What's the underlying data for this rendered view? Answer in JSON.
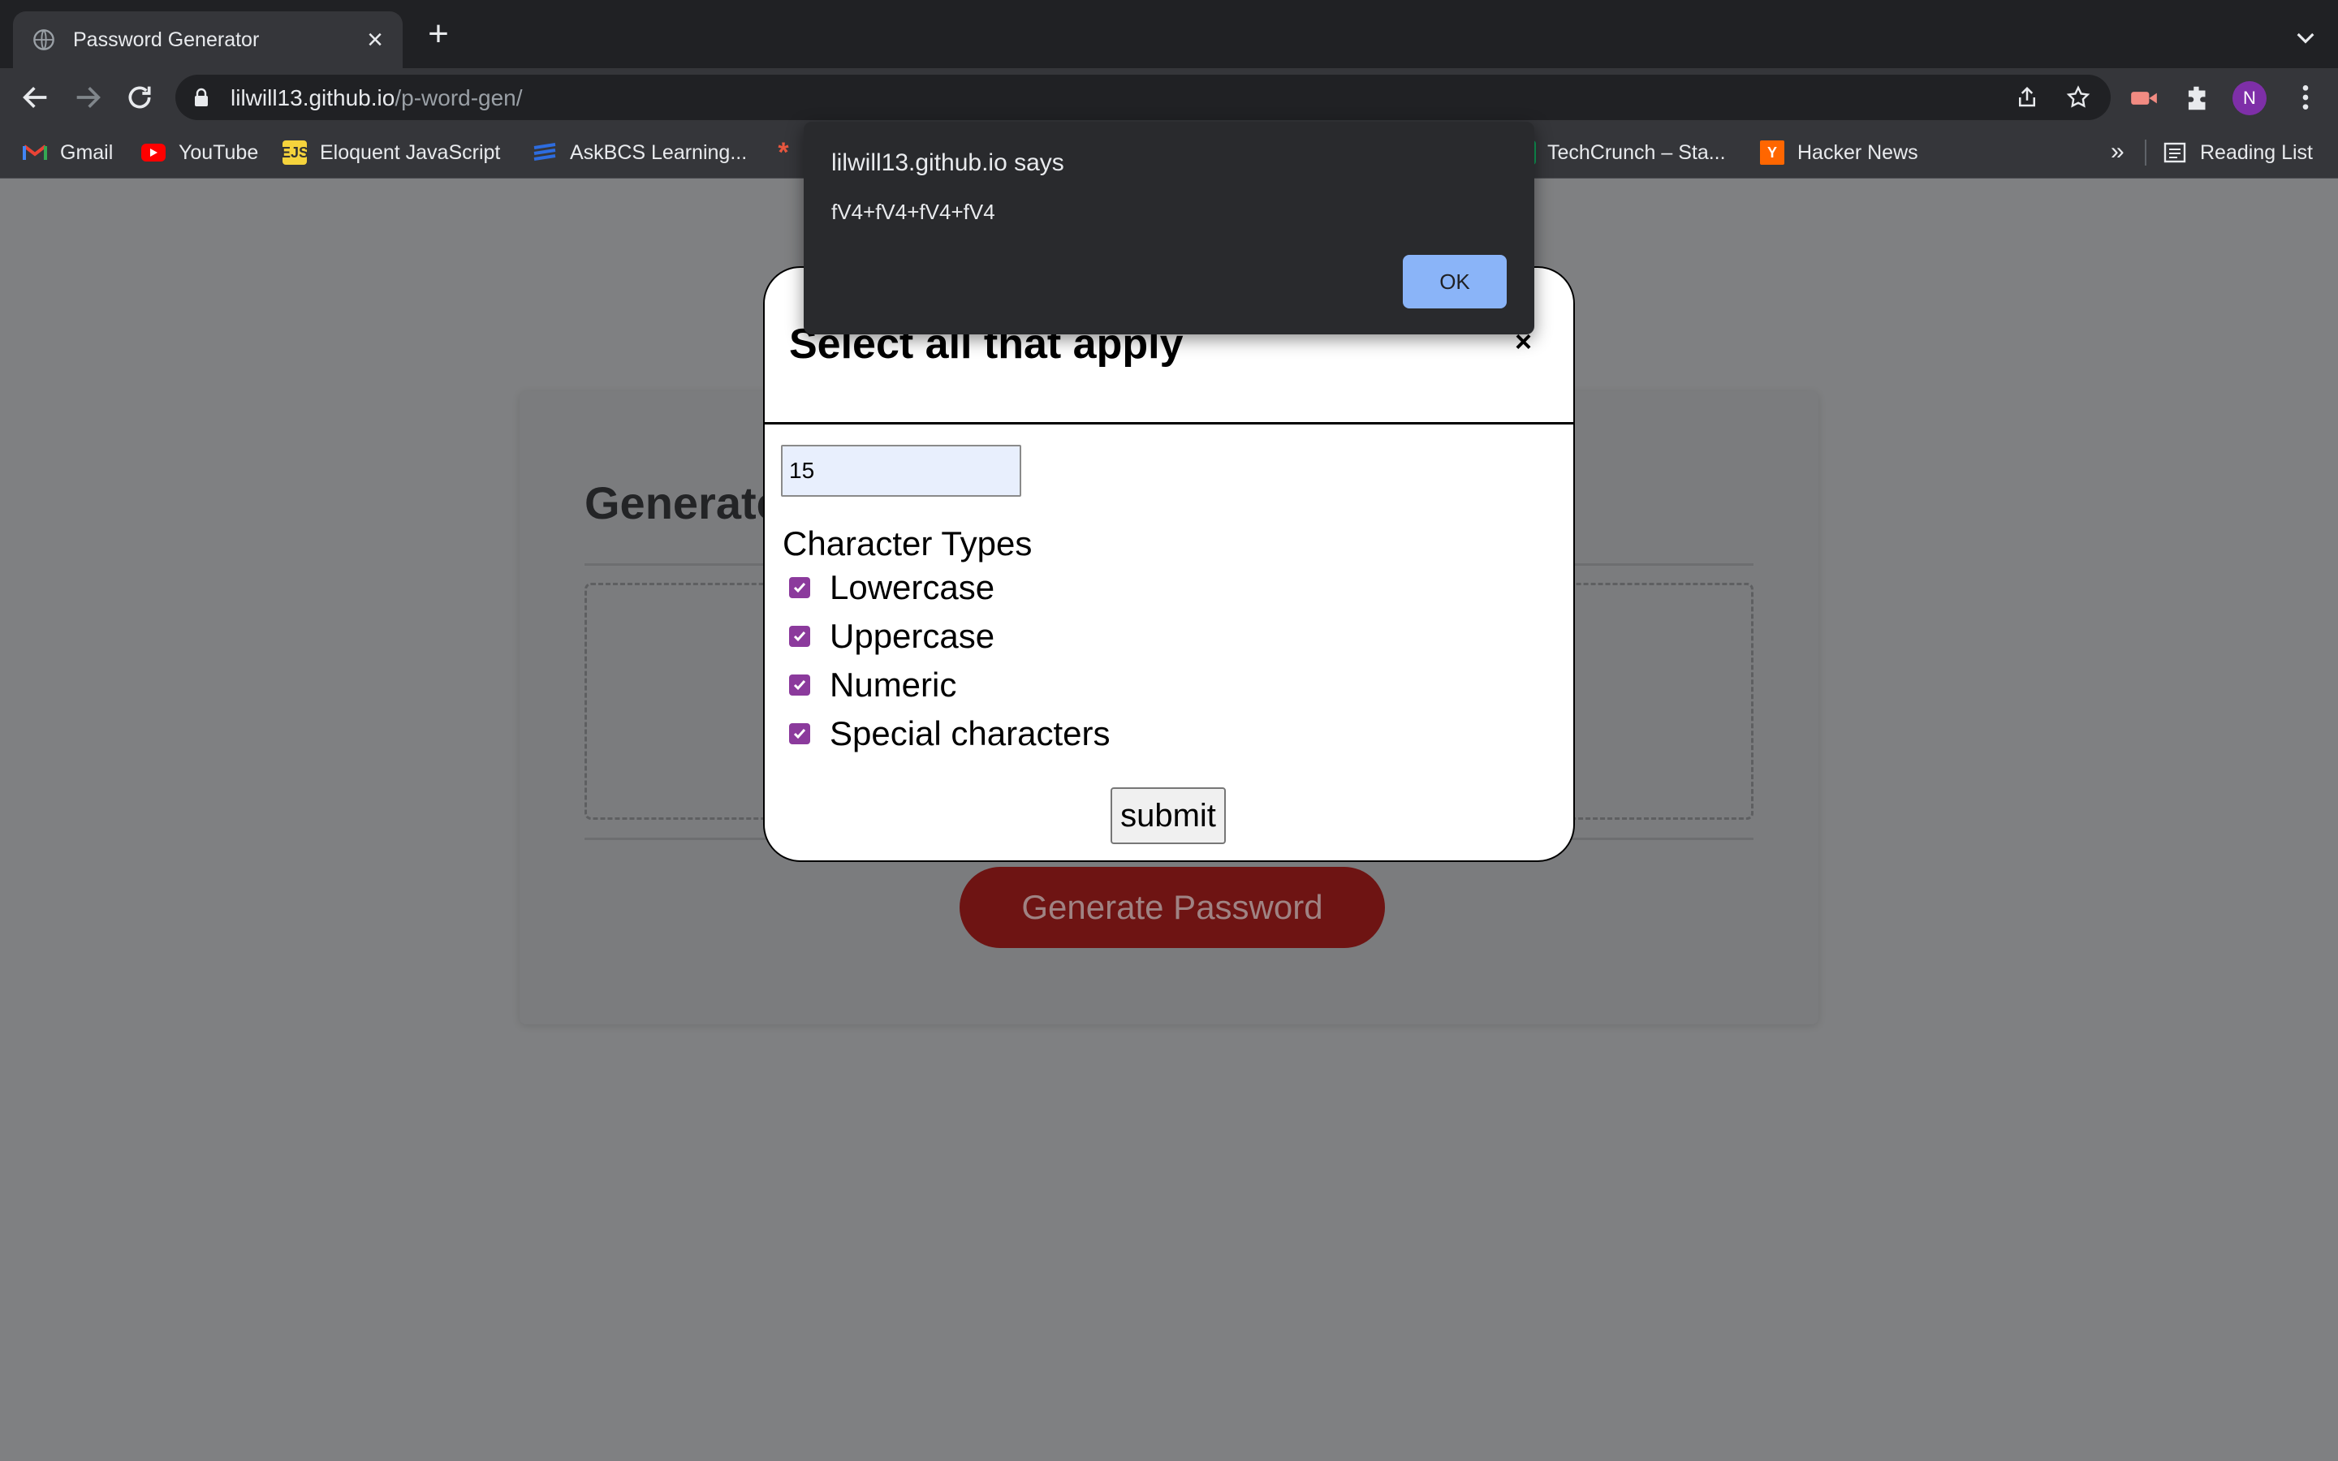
{
  "browser": {
    "tab": {
      "title": "Password Generator"
    },
    "url": {
      "host": "lilwill13.github.io",
      "path": "/p-word-gen/"
    },
    "profile_initial": "N",
    "bookmarks": [
      {
        "label": "Gmail",
        "icon": "gmail-icon"
      },
      {
        "label": "YouTube",
        "icon": "youtube-icon"
      },
      {
        "label": "Eloquent JavaScript",
        "icon": "ejs-icon"
      },
      {
        "label": "AskBCS Learning...",
        "icon": "askbcs-icon"
      },
      {
        "label": "TechCrunch – Sta...",
        "icon": "techcrunch-icon"
      },
      {
        "label": "Hacker News",
        "icon": "hacker-news-icon"
      }
    ],
    "reading_list": "Reading List",
    "more_bookmarks": "»"
  },
  "page": {
    "heading_partial": "Generate",
    "generate_button": "Generate Password"
  },
  "modal": {
    "title": "Select all that apply",
    "close": "×",
    "length_value": "15",
    "section_label": "Character Types",
    "options": [
      {
        "label": "Lowercase",
        "checked": true
      },
      {
        "label": "Uppercase",
        "checked": true
      },
      {
        "label": "Numeric",
        "checked": true
      },
      {
        "label": "Special characters",
        "checked": true
      }
    ],
    "submit": "submit"
  },
  "alert": {
    "origin": "lilwill13.github.io says",
    "message": "fV4+fV4+fV4+fV4",
    "ok": "OK"
  },
  "colors": {
    "accent_checkbox": "#8b3a9c",
    "generate_button": "#6e1413",
    "alert_ok": "#8ab4f8"
  }
}
